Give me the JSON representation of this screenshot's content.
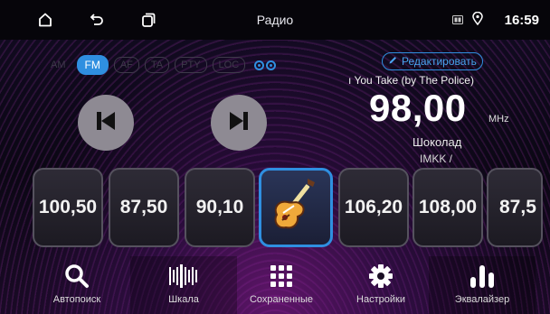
{
  "statusbar": {
    "title": "Радио",
    "time": "16:59",
    "icons": [
      "home-icon",
      "back-icon",
      "recents-icon",
      "sd-card-icon",
      "location-icon"
    ]
  },
  "radio": {
    "modes": [
      "AM",
      "FM",
      "AF",
      "TA",
      "PTY",
      "LOC"
    ],
    "active_mode": "FM",
    "edit_label": "Редактировать",
    "radiotext": "ı You Take (by The Police)",
    "frequency": "98,00",
    "unit": "MHz",
    "station_name": "Шоколад",
    "program_type": "IMKK /"
  },
  "presets": [
    {
      "label": "100,50"
    },
    {
      "label": "87,50"
    },
    {
      "label": "90,10"
    },
    {
      "label": "",
      "icon": "guitar-icon",
      "active": true
    },
    {
      "label": "106,20"
    },
    {
      "label": "108,00"
    },
    {
      "label": "87,5"
    }
  ],
  "nav": [
    {
      "label": "Автопоиск",
      "icon": "search-icon"
    },
    {
      "label": "Шкала",
      "icon": "scale-icon"
    },
    {
      "label": "Сохраненные",
      "icon": "grid-icon"
    },
    {
      "label": "Настройки",
      "icon": "gear-icon"
    },
    {
      "label": "Эквалайзер",
      "icon": "equalizer-icon"
    }
  ],
  "colors": {
    "accent": "#2f8fe0",
    "background": "#0a0714",
    "button_gray": "#8e8a93"
  }
}
